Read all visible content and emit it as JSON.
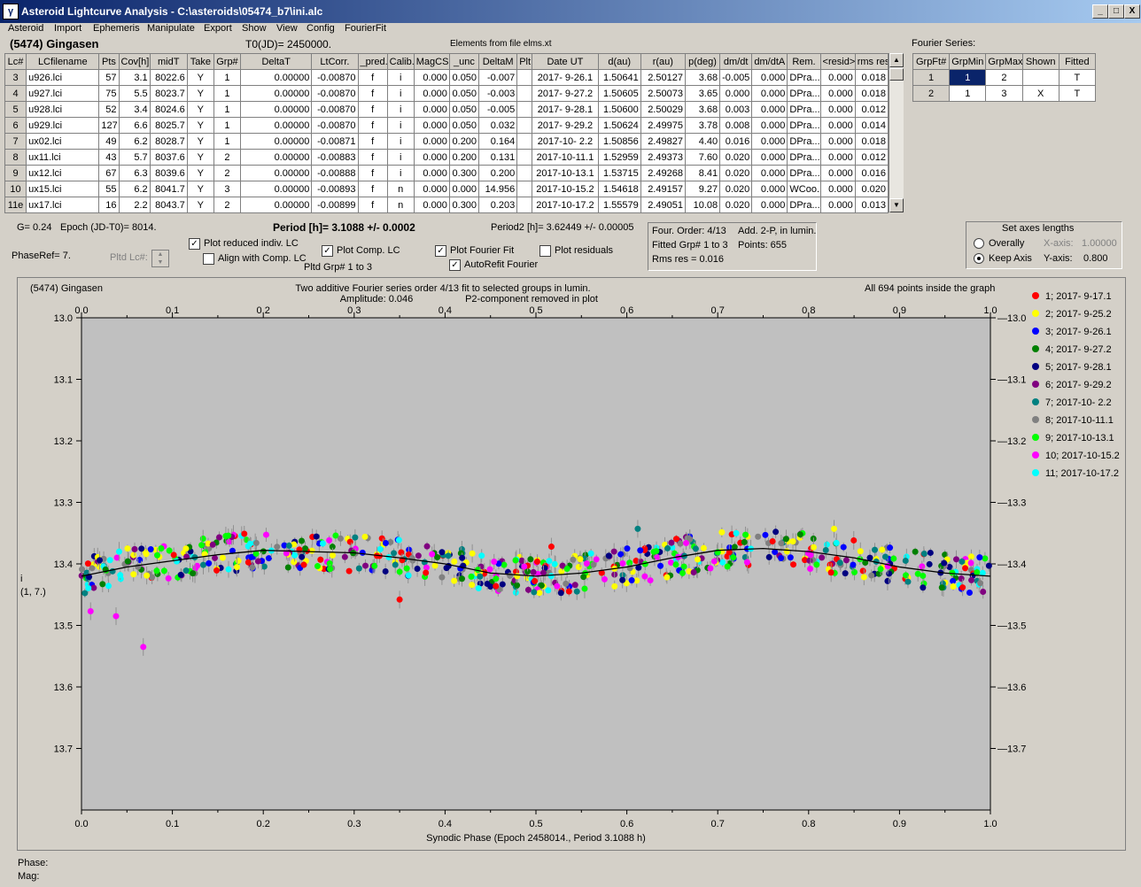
{
  "window": {
    "title": "Asteroid Lightcurve Analysis - C:\\asteroids\\05474_b7\\ini.alc",
    "min": "_",
    "max": "□",
    "close": "X"
  },
  "menu": [
    "Asteroid",
    "Import",
    "Ephemeris",
    "Manipulate",
    "Export",
    "Show",
    "View",
    "Config",
    "FourierFit"
  ],
  "header": {
    "object": "(5474) Gingasen",
    "t0": "T0(JD)= 2450000.",
    "elements": "Elements from file elms.xt"
  },
  "lc_table": {
    "columns": [
      "Lc#",
      "LCfilename",
      "Pts",
      "Cov[h]",
      "midT",
      "Take",
      "Grp#",
      "DeltaT",
      "LtCorr.",
      "_pred.",
      "Calib.",
      "MagCS",
      "_unc",
      "DeltaM",
      "Plt",
      "Date UT",
      "d(au)",
      "r(au)",
      "p(deg)",
      "dm/dt",
      "dm/dtA",
      "Rem.",
      "<resid>",
      "rms res"
    ],
    "rows": [
      [
        "3",
        "u926.lci",
        "57",
        "3.1",
        "8022.6",
        "Y",
        "1",
        "0.00000",
        "-0.00870",
        "f",
        "i",
        "0.000",
        "0.050",
        "-0.007",
        "",
        "2017- 9-26.1",
        "1.50641",
        "2.50127",
        "3.68",
        "-0.005",
        "0.000",
        "DPra...",
        "0.000",
        "0.018"
      ],
      [
        "4",
        "u927.lci",
        "75",
        "5.5",
        "8023.7",
        "Y",
        "1",
        "0.00000",
        "-0.00870",
        "f",
        "i",
        "0.000",
        "0.050",
        "-0.003",
        "",
        "2017- 9-27.2",
        "1.50605",
        "2.50073",
        "3.65",
        "0.000",
        "0.000",
        "DPra...",
        "0.000",
        "0.018"
      ],
      [
        "5",
        "u928.lci",
        "52",
        "3.4",
        "8024.6",
        "Y",
        "1",
        "0.00000",
        "-0.00870",
        "f",
        "i",
        "0.000",
        "0.050",
        "-0.005",
        "",
        "2017- 9-28.1",
        "1.50600",
        "2.50029",
        "3.68",
        "0.003",
        "0.000",
        "DPra...",
        "0.000",
        "0.012"
      ],
      [
        "6",
        "u929.lci",
        "127",
        "6.6",
        "8025.7",
        "Y",
        "1",
        "0.00000",
        "-0.00870",
        "f",
        "i",
        "0.000",
        "0.050",
        "0.032",
        "",
        "2017- 9-29.2",
        "1.50624",
        "2.49975",
        "3.78",
        "0.008",
        "0.000",
        "DPra...",
        "0.000",
        "0.014"
      ],
      [
        "7",
        "ux02.lci",
        "49",
        "6.2",
        "8028.7",
        "Y",
        "1",
        "0.00000",
        "-0.00871",
        "f",
        "i",
        "0.000",
        "0.200",
        "0.164",
        "",
        "2017-10- 2.2",
        "1.50856",
        "2.49827",
        "4.40",
        "0.016",
        "0.000",
        "DPra...",
        "0.000",
        "0.018"
      ],
      [
        "8",
        "ux11.lci",
        "43",
        "5.7",
        "8037.6",
        "Y",
        "2",
        "0.00000",
        "-0.00883",
        "f",
        "i",
        "0.000",
        "0.200",
        "0.131",
        "",
        "2017-10-11.1",
        "1.52959",
        "2.49373",
        "7.60",
        "0.020",
        "0.000",
        "DPra...",
        "0.000",
        "0.012"
      ],
      [
        "9",
        "ux12.lci",
        "67",
        "6.3",
        "8039.6",
        "Y",
        "2",
        "0.00000",
        "-0.00888",
        "f",
        "i",
        "0.000",
        "0.300",
        "0.200",
        "",
        "2017-10-13.1",
        "1.53715",
        "2.49268",
        "8.41",
        "0.020",
        "0.000",
        "DPra...",
        "0.000",
        "0.016"
      ],
      [
        "10",
        "ux15.lci",
        "55",
        "6.2",
        "8041.7",
        "Y",
        "3",
        "0.00000",
        "-0.00893",
        "f",
        "n",
        "0.000",
        "0.000",
        "14.956",
        "",
        "2017-10-15.2",
        "1.54618",
        "2.49157",
        "9.27",
        "0.020",
        "0.000",
        "WCoo...",
        "0.000",
        "0.020"
      ],
      [
        "11e",
        "ux17.lci",
        "16",
        "2.2",
        "8043.7",
        "Y",
        "2",
        "0.00000",
        "-0.00899",
        "f",
        "n",
        "0.000",
        "0.300",
        "0.203",
        "",
        "2017-10-17.2",
        "1.55579",
        "2.49051",
        "10.08",
        "0.020",
        "0.000",
        "DPra...",
        "0.000",
        "0.013"
      ]
    ]
  },
  "fourier_table": {
    "title": "Fourier Series:",
    "columns": [
      "GrpFt#",
      "GrpMin",
      "GrpMax",
      "Shown",
      "Fitted"
    ],
    "rows": [
      [
        "1",
        "1",
        "2",
        "",
        "T"
      ],
      [
        "2",
        "1",
        "3",
        "X",
        "T"
      ]
    ]
  },
  "info": {
    "g": "G= 0.24",
    "epoch": "Epoch (JD-T0)= 8014.",
    "period": "Period [h]= 3.1088 +/- 0.0002",
    "period2": "Period2 [h]= 3.62449 +/- 0.00005",
    "phaseref": "PhaseRef= 7.",
    "pltd_lc": "Pltd Lc#:",
    "pltd_grp": "Pltd Grp#  1   to    3",
    "four_order": "Four. Order:  4/13",
    "add2p": "Add. 2-P, in lumin.",
    "fitted_grp": "Fitted Grp# 1 to 3",
    "points": "Points: 655",
    "rms": "Rms res     = 0.016"
  },
  "checkboxes": {
    "plot_reduced": {
      "label": "Plot reduced indiv. LC",
      "checked": true
    },
    "align_comp": {
      "label": "Align with Comp. LC",
      "checked": false
    },
    "plot_comp": {
      "label": "Plot Comp. LC",
      "checked": true
    },
    "plot_fourier": {
      "label": "Plot Fourier Fit",
      "checked": true
    },
    "autorefit": {
      "label": "AutoRefit Fourier",
      "checked": true
    },
    "plot_residuals": {
      "label": "Plot residuals",
      "checked": false
    }
  },
  "axes_panel": {
    "title": "Set axes lengths",
    "overally": "Overally",
    "keep_axis": "Keep Axis",
    "xaxis_label": "X-axis:",
    "xaxis_val": "1.00000",
    "yaxis_label": "Y-axis:",
    "yaxis_val": "0.800"
  },
  "plot_header": {
    "left": "(5474) Gingasen",
    "center1": "Two additive Fourier series order 4/13 fit to selected groups in lumin.",
    "center2": "Amplitude: 0.046",
    "center3": "P2-component removed in plot",
    "right": "All 694 points inside the graph"
  },
  "chart_data": {
    "type": "scatter",
    "xlabel": "Synodic Phase (Epoch 2458014., Period 3.1088 h)",
    "ylabel": "i",
    "ylabel2": "(1, 7.)",
    "xlim": [
      0,
      1
    ],
    "ylim": [
      13.8,
      13.0
    ],
    "x_ticks": [
      "0.0",
      "0.1",
      "0.2",
      "0.3",
      "0.4",
      "0.5",
      "0.6",
      "0.7",
      "0.8",
      "0.9",
      "1.0"
    ],
    "y_ticks": [
      "13.0",
      "13.1",
      "13.2",
      "13.3",
      "13.4",
      "13.5",
      "13.6",
      "13.7"
    ],
    "legend": [
      {
        "name": "1; 2017- 9-17.1",
        "color": "#ff0000"
      },
      {
        "name": "2; 2017- 9-25.2",
        "color": "#ffff00"
      },
      {
        "name": "3; 2017- 9-26.1",
        "color": "#0000ff"
      },
      {
        "name": "4; 2017- 9-27.2",
        "color": "#008000"
      },
      {
        "name": "5; 2017- 9-28.1",
        "color": "#000080"
      },
      {
        "name": "6; 2017- 9-29.2",
        "color": "#800080"
      },
      {
        "name": "7; 2017-10- 2.2",
        "color": "#008080"
      },
      {
        "name": "8; 2017-10-11.1",
        "color": "#808080"
      },
      {
        "name": "9; 2017-10-13.1",
        "color": "#00ff00"
      },
      {
        "name": "10; 2017-10-15.2",
        "color": "#ff00ff"
      },
      {
        "name": "11; 2017-10-17.2",
        "color": "#00ffff"
      }
    ],
    "fit_curve": {
      "x": [
        0.0,
        0.05,
        0.1,
        0.15,
        0.2,
        0.25,
        0.3,
        0.35,
        0.4,
        0.45,
        0.5,
        0.55,
        0.6,
        0.65,
        0.7,
        0.75,
        0.8,
        0.85,
        0.9,
        0.95,
        1.0
      ],
      "y": [
        13.42,
        13.405,
        13.395,
        13.385,
        13.378,
        13.38,
        13.382,
        13.39,
        13.4,
        13.415,
        13.42,
        13.415,
        13.405,
        13.39,
        13.378,
        13.375,
        13.38,
        13.39,
        13.405,
        13.415,
        13.42
      ]
    },
    "outliers": [
      {
        "x": 0.01,
        "y": 13.477,
        "color": "#ff00ff"
      },
      {
        "x": 0.038,
        "y": 13.485,
        "color": "#ff00ff"
      },
      {
        "x": 0.068,
        "y": 13.535,
        "color": "#ff00ff"
      },
      {
        "x": 0.35,
        "y": 13.458,
        "color": "#ff0000"
      },
      {
        "x": 0.517,
        "y": 13.372,
        "color": "#ff0000"
      },
      {
        "x": 0.612,
        "y": 13.343,
        "color": "#008080"
      },
      {
        "x": 0.828,
        "y": 13.343,
        "color": "#ffff00"
      }
    ]
  },
  "footer": {
    "phase": "Phase:",
    "mag": "Mag:"
  }
}
